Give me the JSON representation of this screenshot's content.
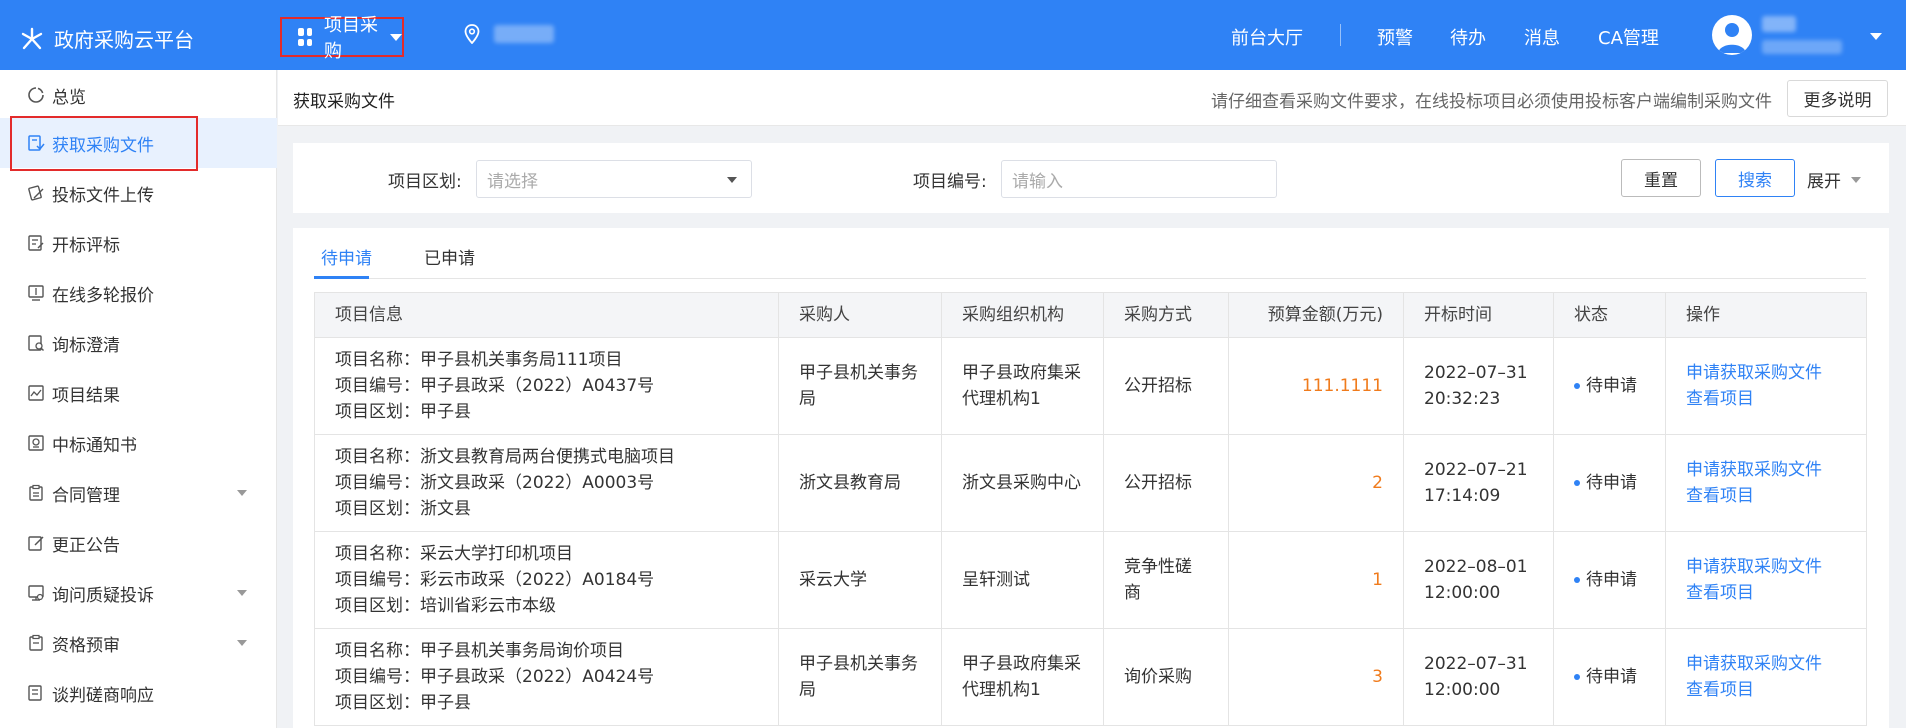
{
  "header": {
    "app_title": "政府采购云平台",
    "module_label": "项目采购",
    "nav": [
      "前台大厅",
      "预警",
      "待办",
      "消息",
      "CA管理"
    ]
  },
  "sidebar": {
    "items": [
      {
        "label": "总览",
        "icon": "overview-icon"
      },
      {
        "label": "获取采购文件",
        "icon": "get-file-icon",
        "active": true
      },
      {
        "label": "投标文件上传",
        "icon": "upload-icon"
      },
      {
        "label": "开标评标",
        "icon": "bid-eval-icon"
      },
      {
        "label": "在线多轮报价",
        "icon": "quote-icon"
      },
      {
        "label": "询标澄清",
        "icon": "clarify-icon"
      },
      {
        "label": "项目结果",
        "icon": "result-icon"
      },
      {
        "label": "中标通知书",
        "icon": "notice-icon"
      },
      {
        "label": "合同管理",
        "icon": "contract-icon",
        "expandable": true
      },
      {
        "label": "更正公告",
        "icon": "correction-icon"
      },
      {
        "label": "询问质疑投诉",
        "icon": "complaint-icon",
        "expandable": true
      },
      {
        "label": "资格预审",
        "icon": "prequal-icon",
        "expandable": true
      },
      {
        "label": "谈判磋商响应",
        "icon": "negotiate-icon"
      }
    ]
  },
  "page": {
    "title": "获取采购文件",
    "hint": "请仔细查看采购文件要求，在线投标项目必须使用投标客户端编制采购文件",
    "more_label": "更多说明"
  },
  "filter": {
    "region_label": "项目区划:",
    "region_placeholder": "请选择",
    "code_label": "项目编号:",
    "code_placeholder": "请输入",
    "reset_label": "重置",
    "search_label": "搜索",
    "expand_label": "展开"
  },
  "tabs": [
    "待申请",
    "已申请"
  ],
  "table": {
    "columns": [
      "项目信息",
      "采购人",
      "采购组织机构",
      "采购方式",
      "预算金额(万元)",
      "开标时间",
      "状态",
      "操作"
    ],
    "rows": [
      {
        "name": "项目名称：甲子县机关事务局111项目",
        "code": "项目编号：甲子县政采（2022）A0437号",
        "region": "项目区划：甲子县",
        "buyer": "甲子县机关事务局",
        "agency": "甲子县政府集采代理机构1",
        "method": "公开招标",
        "budget": "111.1111",
        "date": "2022–07–31",
        "time": "20:32:23",
        "status": "待申请",
        "action1": "申请获取采购文件",
        "action2": "查看项目"
      },
      {
        "name": "项目名称：浙文县教育局两台便携式电脑项目",
        "code": "项目编号：浙文县政采（2022）A0003号",
        "region": "项目区划：浙文县",
        "buyer": "浙文县教育局",
        "agency": "浙文县采购中心",
        "method": "公开招标",
        "budget": "2",
        "date": "2022–07–21",
        "time": "17:14:09",
        "status": "待申请",
        "action1": "申请获取采购文件",
        "action2": "查看项目"
      },
      {
        "name": "项目名称：采云大学打印机项目",
        "code": "项目编号：彩云市政采（2022）A0184号",
        "region": "项目区划：培训省彩云市本级",
        "buyer": "采云大学",
        "agency": "呈轩测试",
        "method": "竞争性磋商",
        "budget": "1",
        "date": "2022–08–01",
        "time": "12:00:00",
        "status": "待申请",
        "action1": "申请获取采购文件",
        "action2": "查看项目"
      },
      {
        "name": "项目名称：甲子县机关事务局询价项目",
        "code": "项目编号：甲子县政采（2022）A0424号",
        "region": "项目区划：甲子县",
        "buyer": "甲子县机关事务局",
        "agency": "甲子县政府集采代理机构1",
        "method": "询价采购",
        "budget": "3",
        "date": "2022–07–31",
        "time": "12:00:00",
        "status": "待申请",
        "action1": "申请获取采购文件",
        "action2": "查看项目"
      }
    ]
  }
}
